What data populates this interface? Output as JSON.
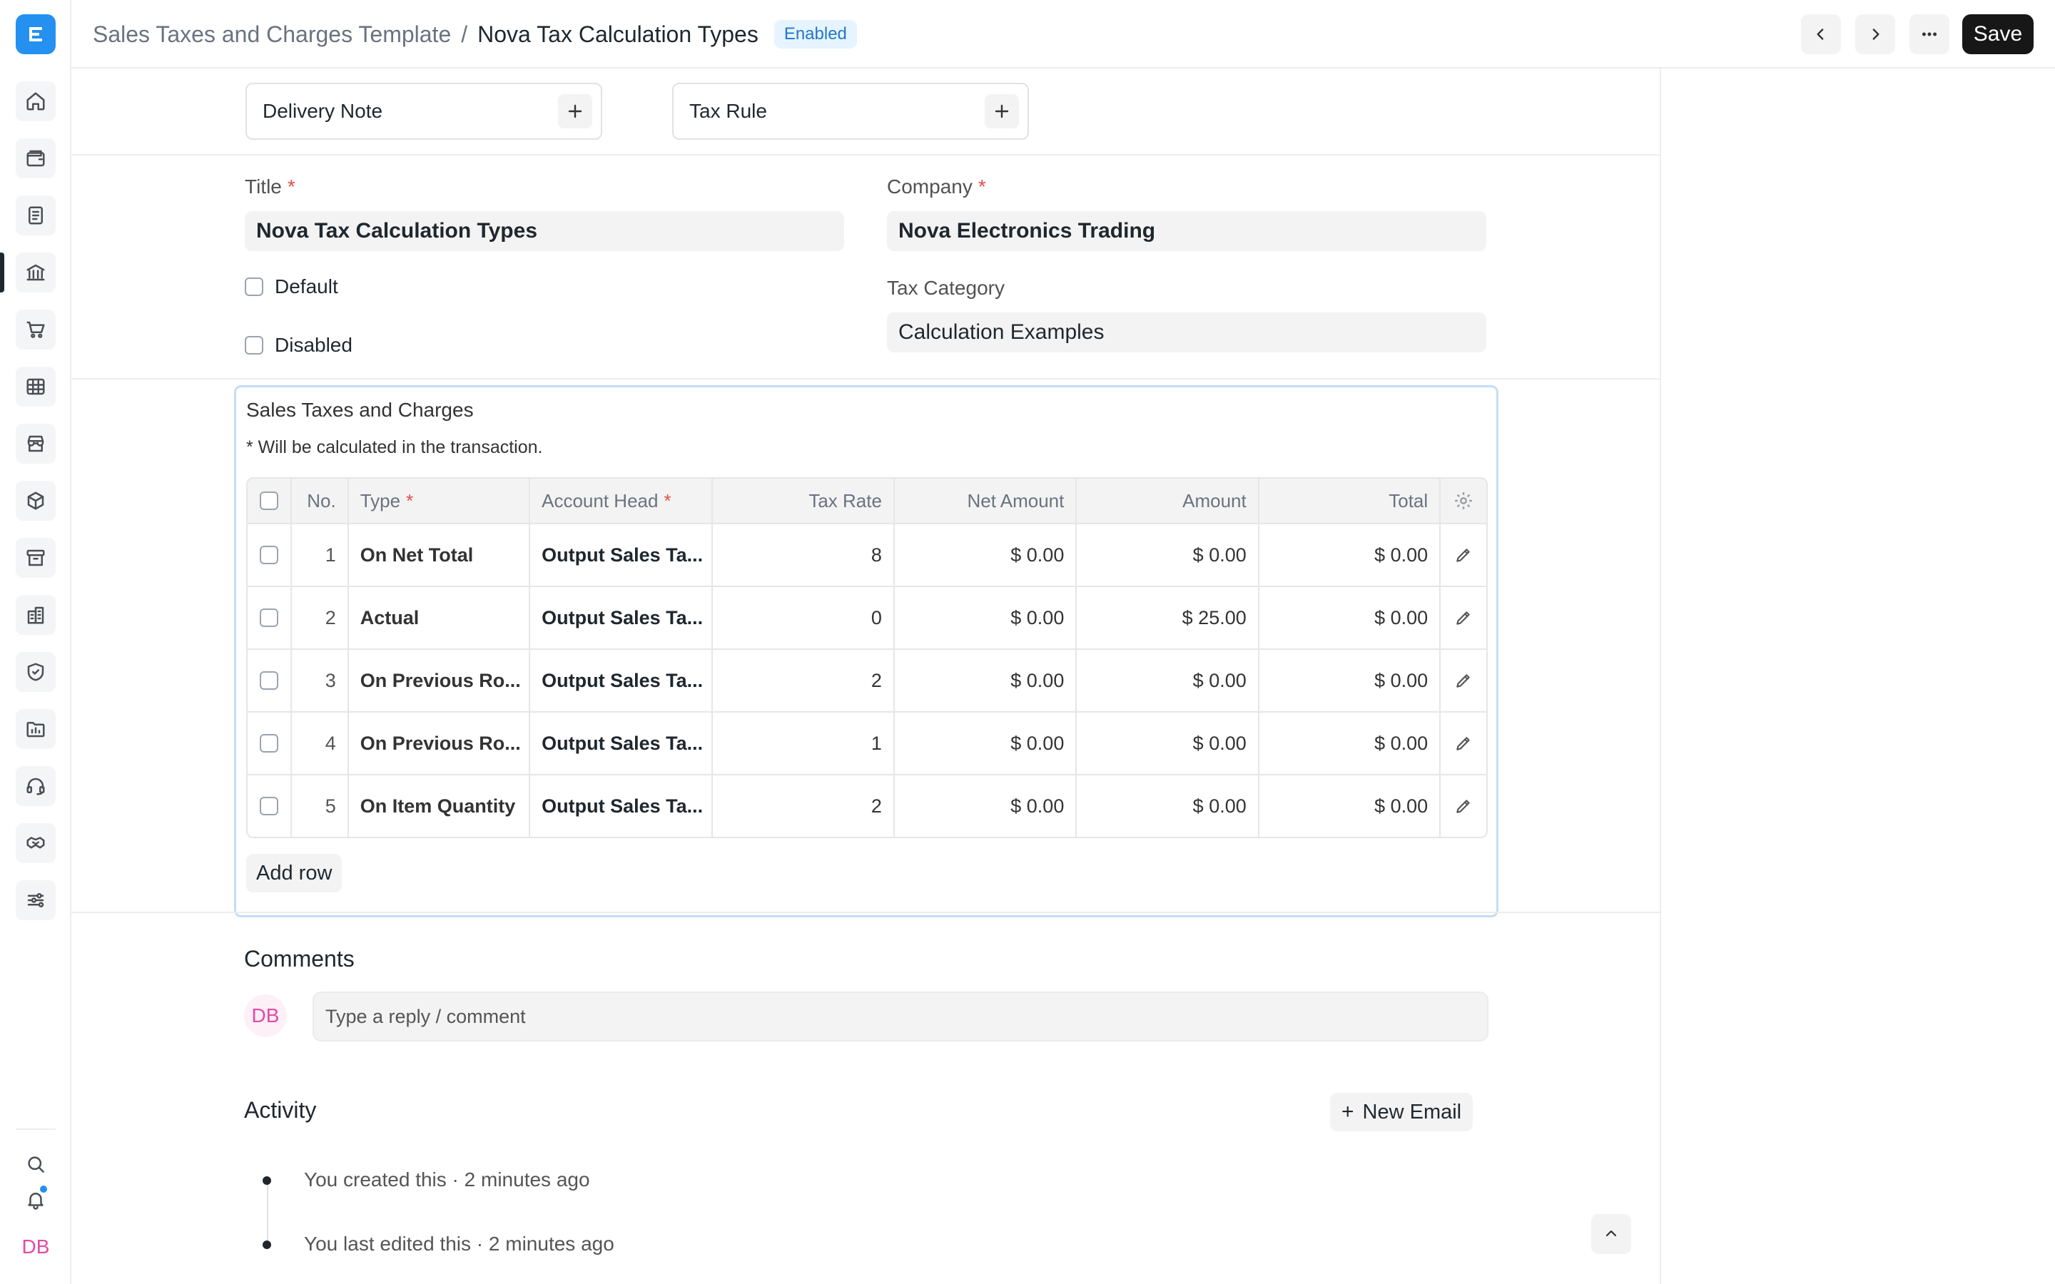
{
  "header": {
    "parent": "Sales Taxes and Charges Template",
    "separator": "/",
    "title": "Nova Tax Calculation Types",
    "status": "Enabled",
    "save_label": "Save"
  },
  "links": {
    "delivery_note": "Delivery Note",
    "tax_rule": "Tax Rule"
  },
  "form": {
    "title_label": "Title",
    "title_value": "Nova Tax Calculation Types",
    "company_label": "Company",
    "company_value": "Nova Electronics Trading",
    "default_label": "Default",
    "disabled_label": "Disabled",
    "tax_category_label": "Tax Category",
    "tax_category_value": "Calculation Examples",
    "required_mark": "*"
  },
  "taxes": {
    "title": "Sales Taxes and Charges",
    "description": "* Will be calculated in the transaction.",
    "columns": {
      "no": "No.",
      "type": "Type",
      "account_head": "Account Head",
      "tax_rate": "Tax Rate",
      "net_amount": "Net Amount",
      "amount": "Amount",
      "total": "Total"
    },
    "rows": [
      {
        "no": "1",
        "type": "On Net Total",
        "account": "Output Sales Ta...",
        "rate": "8",
        "net": "$ 0.00",
        "amount": "$ 0.00",
        "total": "$ 0.00"
      },
      {
        "no": "2",
        "type": "Actual",
        "account": "Output Sales Ta...",
        "rate": "0",
        "net": "$ 0.00",
        "amount": "$ 25.00",
        "total": "$ 0.00"
      },
      {
        "no": "3",
        "type": "On Previous Ro...",
        "account": "Output Sales Ta...",
        "rate": "2",
        "net": "$ 0.00",
        "amount": "$ 0.00",
        "total": "$ 0.00"
      },
      {
        "no": "4",
        "type": "On Previous Ro...",
        "account": "Output Sales Ta...",
        "rate": "1",
        "net": "$ 0.00",
        "amount": "$ 0.00",
        "total": "$ 0.00"
      },
      {
        "no": "5",
        "type": "On Item Quantity",
        "account": "Output Sales Ta...",
        "rate": "2",
        "net": "$ 0.00",
        "amount": "$ 0.00",
        "total": "$ 0.00"
      }
    ],
    "add_row_label": "Add row"
  },
  "comments": {
    "title": "Comments",
    "avatar_initials": "DB",
    "placeholder": "Type a reply / comment"
  },
  "activity": {
    "title": "Activity",
    "new_email_label": "New Email",
    "items": [
      {
        "text": "You created this · 2 minutes ago"
      },
      {
        "text": "You last edited this · 2 minutes ago"
      }
    ]
  },
  "sidebar": {
    "user_initials": "DB",
    "icons": [
      "home-icon",
      "wallet-icon",
      "document-icon",
      "bank-icon",
      "cart-icon",
      "table-icon",
      "store-icon",
      "package-icon",
      "archive-icon",
      "building-icon",
      "shield-icon",
      "folder-chart-icon",
      "headset-icon",
      "handshake-icon",
      "sliders-icon"
    ]
  },
  "colors": {
    "accent": "#2490ef",
    "badge_bg": "#e6f4ff",
    "badge_text": "#2377c9",
    "avatar": "#e34aa6"
  }
}
